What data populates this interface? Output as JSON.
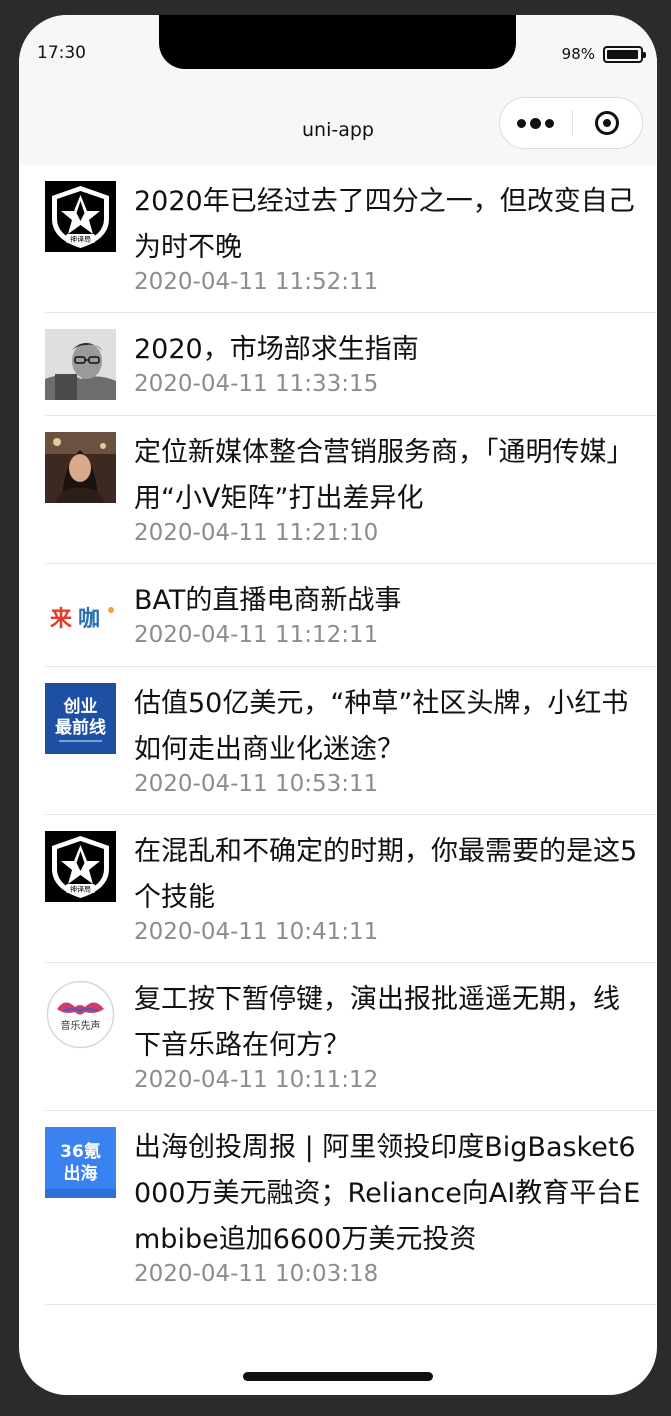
{
  "status": {
    "time": "17:30",
    "battery": "98%"
  },
  "nav": {
    "title": "uni-app"
  },
  "articles": [
    {
      "title": "2020年已经过去了四分之一，但改变自己为时不晚",
      "date": "2020-04-11 11:52:11",
      "avatar": "shield-logo-avatar"
    },
    {
      "title": "2020，市场部求生指南",
      "date": "2020-04-11 11:33:15",
      "avatar": "man-with-glasses-photo"
    },
    {
      "title": "定位新媒体整合营销服务商，「通明传媒」用“小V矩阵”打出差异化",
      "date": "2020-04-11 11:21:10",
      "avatar": "woman-portrait-photo"
    },
    {
      "title": "BAT的直播电商新战事",
      "date": "2020-04-11 11:12:11",
      "avatar": "来咖-logo"
    },
    {
      "title": "估值50亿美元，“种草”社区头牌，小红书如何走出商业化迷途？",
      "date": "2020-04-11 10:53:11",
      "avatar": "创业最前线-logo"
    },
    {
      "title": "在混乱和不确定的时期，你最需要的是这5个技能",
      "date": "2020-04-11 10:41:11",
      "avatar": "shield-logo-avatar"
    },
    {
      "title": "复工按下暂停键，演出报批遥遥无期，线下音乐路在何方？",
      "date": "2020-04-11 10:11:12",
      "avatar": "音乐先声-logo"
    },
    {
      "title": "出海创投周报 | 阿里领投印度BigBasket6000万美元融资；Reliance向AI教育平台Embibe追加6600万美元投资",
      "date": "2020-04-11 10:03:18",
      "avatar": "36氪出海-logo"
    }
  ],
  "logos": {
    "shield": "神译局",
    "laika": [
      "来",
      "咖"
    ],
    "chuangye": [
      "创业",
      "最前线"
    ],
    "yinyue": "音乐先声",
    "kr36": [
      "36氪",
      "出海"
    ]
  }
}
